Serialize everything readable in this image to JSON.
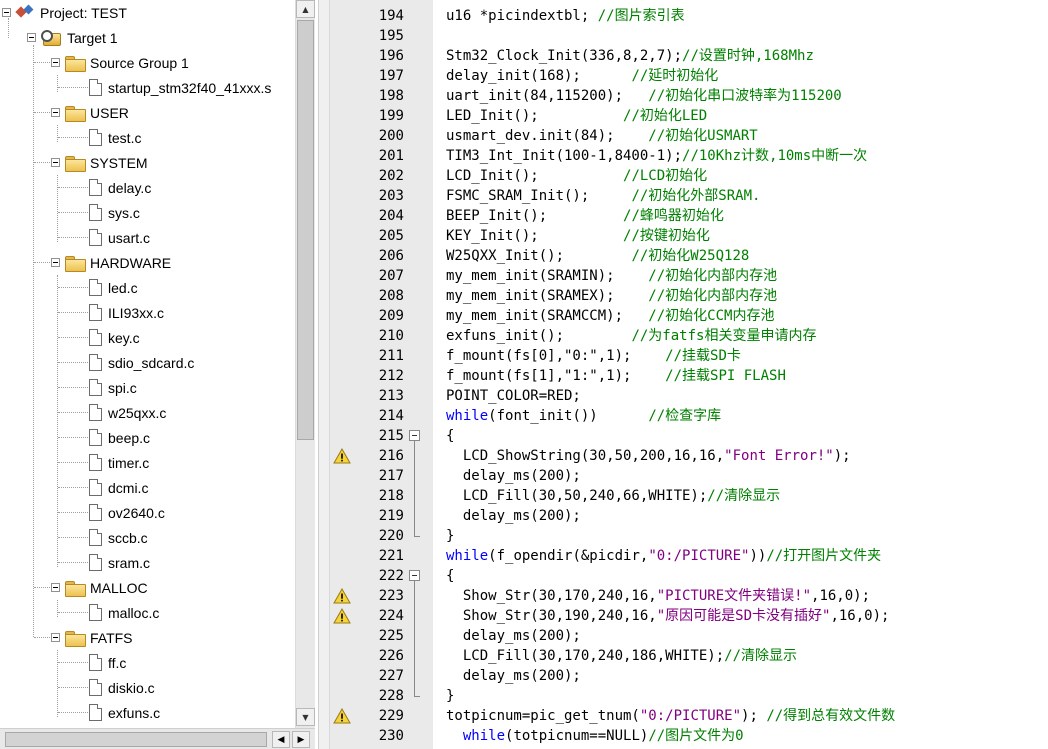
{
  "project_tree": {
    "project_label": "Project: TEST",
    "target_label": "Target 1",
    "groups": [
      {
        "label": "Source Group 1",
        "files": [
          "startup_stm32f40_41xxx.s"
        ]
      },
      {
        "label": "USER",
        "files": [
          "test.c"
        ]
      },
      {
        "label": "SYSTEM",
        "files": [
          "delay.c",
          "sys.c",
          "usart.c"
        ]
      },
      {
        "label": "HARDWARE",
        "files": [
          "led.c",
          "ILI93xx.c",
          "key.c",
          "sdio_sdcard.c",
          "spi.c",
          "w25qxx.c",
          "beep.c",
          "timer.c",
          "dcmi.c",
          "ov2640.c",
          "sccb.c",
          "sram.c"
        ]
      },
      {
        "label": "MALLOC",
        "files": [
          "malloc.c"
        ]
      },
      {
        "label": "FATFS",
        "files": [
          "ff.c",
          "diskio.c",
          "exfuns.c"
        ]
      }
    ]
  },
  "scrollbars": {
    "up_arrow": "▲",
    "down_arrow": "▼",
    "left_arrow": "◀",
    "right_arrow": "▶"
  },
  "editor": {
    "icons": {
      "warning": "warning-icon",
      "fold": "fold-minus-icon"
    },
    "lines": [
      {
        "num": "194",
        "parts": [
          [
            "code",
            "u16 *picindextbl; "
          ],
          [
            "cmt",
            "//图片索引表"
          ]
        ]
      },
      {
        "num": "195",
        "parts": []
      },
      {
        "num": "196",
        "parts": [
          [
            "code",
            "Stm32_Clock_Init(336,8,2,7);"
          ],
          [
            "cmt",
            "//设置时钟,168Mhz"
          ]
        ]
      },
      {
        "num": "197",
        "parts": [
          [
            "code",
            "delay_init(168);      "
          ],
          [
            "cmt",
            "//延时初始化"
          ]
        ]
      },
      {
        "num": "198",
        "parts": [
          [
            "code",
            "uart_init(84,115200);   "
          ],
          [
            "cmt",
            "//初始化串口波特率为115200"
          ]
        ]
      },
      {
        "num": "199",
        "parts": [
          [
            "code",
            "LED_Init();          "
          ],
          [
            "cmt",
            "//初始化LED"
          ]
        ]
      },
      {
        "num": "200",
        "parts": [
          [
            "code",
            "usmart_dev.init(84);    "
          ],
          [
            "cmt",
            "//初始化USMART"
          ]
        ]
      },
      {
        "num": "201",
        "parts": [
          [
            "code",
            "TIM3_Int_Init(100-1,8400-1);"
          ],
          [
            "cmt",
            "//10Khz计数,10ms中断一次"
          ]
        ]
      },
      {
        "num": "202",
        "parts": [
          [
            "code",
            "LCD_Init();          "
          ],
          [
            "cmt",
            "//LCD初始化"
          ]
        ]
      },
      {
        "num": "203",
        "parts": [
          [
            "code",
            "FSMC_SRAM_Init();     "
          ],
          [
            "cmt",
            "//初始化外部SRAM."
          ]
        ]
      },
      {
        "num": "204",
        "parts": [
          [
            "code",
            "BEEP_Init();         "
          ],
          [
            "cmt",
            "//蜂鸣器初始化"
          ]
        ]
      },
      {
        "num": "205",
        "parts": [
          [
            "code",
            "KEY_Init();          "
          ],
          [
            "cmt",
            "//按键初始化"
          ]
        ]
      },
      {
        "num": "206",
        "parts": [
          [
            "code",
            "W25QXX_Init();        "
          ],
          [
            "cmt",
            "//初始化W25Q128"
          ]
        ]
      },
      {
        "num": "207",
        "parts": [
          [
            "code",
            "my_mem_init(SRAMIN);    "
          ],
          [
            "cmt",
            "//初始化内部内存池"
          ]
        ]
      },
      {
        "num": "208",
        "parts": [
          [
            "code",
            "my_mem_init(SRAMEX);    "
          ],
          [
            "cmt",
            "//初始化内部内存池"
          ]
        ]
      },
      {
        "num": "209",
        "parts": [
          [
            "code",
            "my_mem_init(SRAMCCM);   "
          ],
          [
            "cmt",
            "//初始化CCM内存池"
          ]
        ]
      },
      {
        "num": "210",
        "parts": [
          [
            "code",
            "exfuns_init();        "
          ],
          [
            "cmt",
            "//为fatfs相关变量申请内存"
          ]
        ]
      },
      {
        "num": "211",
        "parts": [
          [
            "code",
            "f_mount(fs[0],\"0:\",1);    "
          ],
          [
            "cmt",
            "//挂载SD卡"
          ]
        ]
      },
      {
        "num": "212",
        "parts": [
          [
            "code",
            "f_mount(fs[1],\"1:\",1);    "
          ],
          [
            "cmt",
            "//挂载SPI FLASH"
          ]
        ]
      },
      {
        "num": "213",
        "parts": [
          [
            "code",
            "POINT_COLOR=RED;"
          ]
        ]
      },
      {
        "num": "214",
        "parts": [
          [
            "kw",
            "while"
          ],
          [
            "code",
            "(font_init())      "
          ],
          [
            "cmt",
            "//检查字库"
          ]
        ]
      },
      {
        "num": "215",
        "parts": [
          [
            "code",
            "{"
          ]
        ],
        "fold": "start"
      },
      {
        "num": "216",
        "warn": true,
        "parts": [
          [
            "code",
            "  LCD_ShowString(30,50,200,16,16,"
          ],
          [
            "str",
            "\"Font Error!\""
          ],
          [
            "code",
            ");"
          ]
        ]
      },
      {
        "num": "217",
        "parts": [
          [
            "code",
            "  delay_ms(200);"
          ]
        ]
      },
      {
        "num": "218",
        "parts": [
          [
            "code",
            "  LCD_Fill(30,50,240,66,WHITE);"
          ],
          [
            "cmt",
            "//清除显示"
          ]
        ]
      },
      {
        "num": "219",
        "parts": [
          [
            "code",
            "  delay_ms(200);"
          ]
        ]
      },
      {
        "num": "220",
        "parts": [
          [
            "code",
            "}"
          ]
        ],
        "fold": "end"
      },
      {
        "num": "221",
        "parts": [
          [
            "kw",
            "while"
          ],
          [
            "code",
            "(f_opendir(&picdir,"
          ],
          [
            "str",
            "\"0:/PICTURE\""
          ],
          [
            "code",
            "))"
          ],
          [
            "cmt",
            "//打开图片文件夹"
          ]
        ]
      },
      {
        "num": "222",
        "parts": [
          [
            "code",
            "{"
          ]
        ],
        "fold": "start"
      },
      {
        "num": "223",
        "warn": true,
        "parts": [
          [
            "code",
            "  Show_Str(30,170,240,16,"
          ],
          [
            "str",
            "\"PICTURE文件夹错误!\""
          ],
          [
            "code",
            ",16,0);"
          ]
        ]
      },
      {
        "num": "224",
        "warn": true,
        "parts": [
          [
            "code",
            "  Show_Str(30,190,240,16,"
          ],
          [
            "str",
            "\"原因可能是SD卡没有插好\""
          ],
          [
            "code",
            ",16,0);"
          ]
        ]
      },
      {
        "num": "225",
        "parts": [
          [
            "code",
            "  delay_ms(200);"
          ]
        ]
      },
      {
        "num": "226",
        "parts": [
          [
            "code",
            "  LCD_Fill(30,170,240,186,WHITE);"
          ],
          [
            "cmt",
            "//清除显示"
          ]
        ]
      },
      {
        "num": "227",
        "parts": [
          [
            "code",
            "  delay_ms(200);"
          ]
        ]
      },
      {
        "num": "228",
        "parts": [
          [
            "code",
            "}"
          ]
        ],
        "fold": "end"
      },
      {
        "num": "229",
        "warn": true,
        "parts": [
          [
            "code",
            "totpicnum=pic_get_tnum("
          ],
          [
            "str",
            "\"0:/PICTURE\""
          ],
          [
            "code",
            "); "
          ],
          [
            "cmt",
            "//得到总有效文件数"
          ]
        ]
      },
      {
        "num": "230",
        "parts": [
          [
            "code",
            "  "
          ],
          [
            "kw",
            "while"
          ],
          [
            "code",
            "(totpicnum==NULL)"
          ],
          [
            "cmt",
            "//图片文件为0"
          ]
        ]
      }
    ]
  }
}
